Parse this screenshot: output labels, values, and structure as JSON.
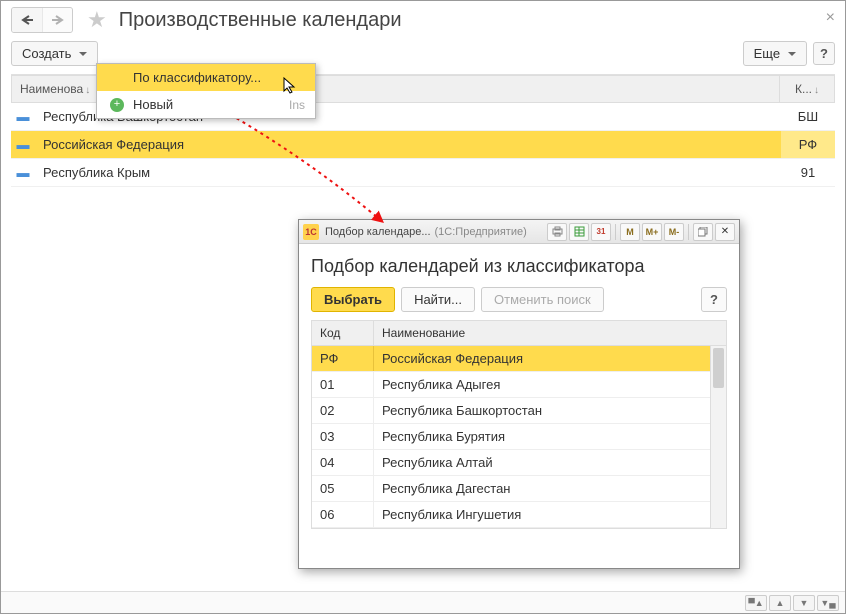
{
  "header": {
    "title": "Производственные календари"
  },
  "toolbar": {
    "create_label": "Создать",
    "more_label": "Еще",
    "help_label": "?"
  },
  "context_menu": {
    "by_classifier": "По классификатору...",
    "new_label": "Новый",
    "new_shortcut": "Ins"
  },
  "grid": {
    "col_name": "Наименова",
    "col_code": "К...",
    "rows": [
      {
        "name": "Республика Башкортостан",
        "code": "БШ",
        "selected": false
      },
      {
        "name": "Российская Федерация",
        "code": "РФ",
        "selected": true
      },
      {
        "name": "Республика Крым",
        "code": "91",
        "selected": false
      }
    ]
  },
  "dialog": {
    "tb_title": "Подбор календаре...",
    "tb_sub": "(1С:Предприятие)",
    "heading": "Подбор календарей из классификатора",
    "btn_select": "Выбрать",
    "btn_find": "Найти...",
    "btn_cancel": "Отменить поиск",
    "help_label": "?",
    "col_code": "Код",
    "col_name": "Наименование",
    "rows": [
      {
        "code": "РФ",
        "name": "Российская Федерация",
        "selected": true
      },
      {
        "code": "01",
        "name": "Республика Адыгея",
        "selected": false
      },
      {
        "code": "02",
        "name": "Республика Башкортостан",
        "selected": false
      },
      {
        "code": "03",
        "name": "Республика Бурятия",
        "selected": false
      },
      {
        "code": "04",
        "name": "Республика Алтай",
        "selected": false
      },
      {
        "code": "05",
        "name": "Республика Дагестан",
        "selected": false
      },
      {
        "code": "06",
        "name": "Республика Ингушетия",
        "selected": false
      }
    ],
    "tb_icons": {
      "m": "M",
      "mplus": "M+",
      "mminus": "M-",
      "cal31": "31"
    }
  }
}
